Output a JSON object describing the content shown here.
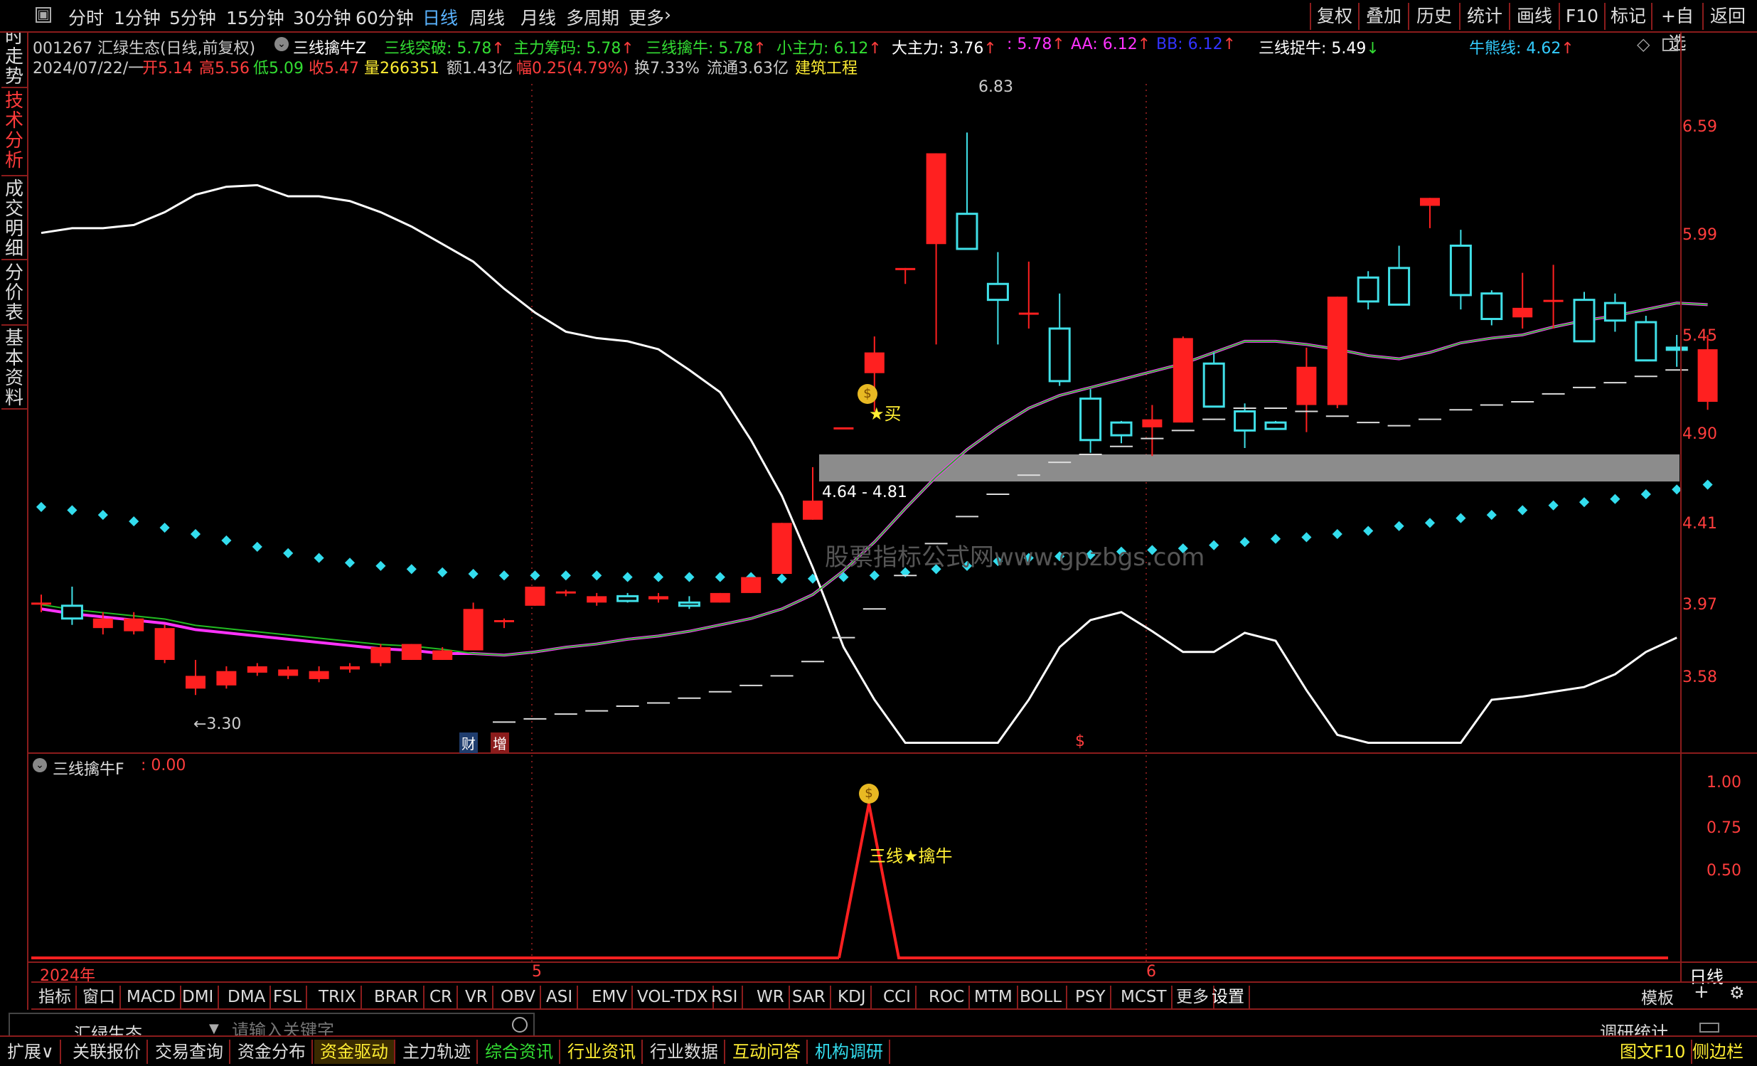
{
  "toolbar": {
    "left_tabs": [
      "分时",
      "1分钟",
      "5分钟",
      "15分钟",
      "30分钟",
      "60分钟",
      "日线",
      "周线",
      "月线",
      "多周期",
      "更多"
    ],
    "active_tab": "日线",
    "right_buttons": [
      "复权",
      "叠加",
      "历史",
      "统计",
      "画线",
      "F10",
      "标记",
      "+自选",
      "返回"
    ]
  },
  "sidebar": {
    "tabs": [
      "分时走势",
      "技术分析",
      "成交明细",
      "分价表",
      "基本资料"
    ],
    "active": "技术分析"
  },
  "header": {
    "stock": "001267 汇绿生态(日线,前复权)",
    "indicator_name": "三线擒牛Z",
    "items": [
      {
        "label": "三线突破: 5.78",
        "arrow": "↑",
        "color": "#33dd33"
      },
      {
        "label": "主力筹码: 5.78",
        "arrow": "↑",
        "color": "#33dd33"
      },
      {
        "label": "三线擒牛: 5.78",
        "arrow": "↑",
        "color": "#33dd33"
      },
      {
        "label": "小主力: 6.12",
        "arrow": "↑",
        "color": "#33dd33"
      },
      {
        "label": "大主力: 3.76",
        "arrow": "↑",
        "color": "#ffffff"
      },
      {
        "label": ": 5.78",
        "arrow": "↑",
        "color": "#ff33ff"
      },
      {
        "label": "AA: 6.12",
        "arrow": "↑",
        "color": "#ff33ff"
      },
      {
        "label": "BB: 6.12",
        "arrow": "↑",
        "color": "#3333ff"
      },
      {
        "label": "三线捉牛: 5.49",
        "arrow": "↓",
        "color": "#ffffff"
      },
      {
        "label": "牛熊线: 4.62",
        "arrow": "↑",
        "color": "#33ccff"
      }
    ],
    "date": "2024/07/22/一",
    "open": "开5.14",
    "high": "高5.56",
    "low": "低5.09",
    "close": "收5.47",
    "volume": "量266351",
    "amount": "额1.43亿",
    "change": "幅0.25(4.79%)",
    "turnover": "换7.33%",
    "float": "流通3.63亿",
    "industry": "建筑工程"
  },
  "main_chart": {
    "price_axis": [
      "6.59",
      "5.99",
      "5.45",
      "4.90",
      "4.41",
      "3.97",
      "3.58"
    ],
    "high_label": "6.83",
    "low_label": "←3.30",
    "zone_label": "4.64 - 4.81",
    "buy_label": "★买",
    "events": [
      "财",
      "增",
      "$"
    ],
    "watermark": "股票指标公式网www.gpzbgs.com"
  },
  "chart_data": {
    "type": "candlestick",
    "period": "daily",
    "ohlc": [
      [
        3.88,
        3.93,
        3.82,
        3.88
      ],
      [
        3.86,
        3.98,
        3.74,
        3.78
      ],
      [
        3.72,
        3.82,
        3.68,
        3.78
      ],
      [
        3.7,
        3.82,
        3.68,
        3.78
      ],
      [
        3.52,
        3.74,
        3.5,
        3.72
      ],
      [
        3.34,
        3.52,
        3.3,
        3.42
      ],
      [
        3.36,
        3.48,
        3.34,
        3.45
      ],
      [
        3.44,
        3.5,
        3.42,
        3.48
      ],
      [
        3.42,
        3.48,
        3.4,
        3.46
      ],
      [
        3.4,
        3.48,
        3.38,
        3.45
      ],
      [
        3.46,
        3.5,
        3.44,
        3.48
      ],
      [
        3.5,
        3.62,
        3.48,
        3.6
      ],
      [
        3.52,
        3.62,
        3.52,
        3.62
      ],
      [
        3.52,
        3.6,
        3.52,
        3.58
      ],
      [
        3.58,
        3.88,
        3.58,
        3.84
      ],
      [
        3.77,
        3.78,
        3.72,
        3.77
      ],
      [
        3.86,
        3.98,
        3.86,
        3.98
      ],
      [
        3.94,
        3.96,
        3.92,
        3.95
      ],
      [
        3.88,
        3.94,
        3.86,
        3.92
      ],
      [
        3.92,
        3.94,
        3.88,
        3.89
      ],
      [
        3.9,
        3.94,
        3.88,
        3.92
      ],
      [
        3.88,
        3.92,
        3.84,
        3.86
      ],
      [
        3.88,
        3.94,
        3.88,
        3.94
      ],
      [
        3.94,
        4.04,
        3.94,
        4.04
      ],
      [
        4.06,
        4.38,
        4.06,
        4.38
      ],
      [
        4.4,
        4.73,
        4.4,
        4.52
      ],
      [
        4.98,
        4.98,
        4.98,
        4.98
      ],
      [
        5.32,
        5.55,
        5.08,
        5.45
      ],
      [
        5.98,
        5.98,
        5.88,
        5.98
      ],
      [
        6.13,
        6.7,
        5.5,
        6.7
      ],
      [
        6.32,
        6.83,
        6.22,
        6.1
      ],
      [
        5.88,
        6.08,
        5.5,
        5.78
      ],
      [
        5.7,
        6.02,
        5.6,
        5.7
      ],
      [
        5.6,
        5.82,
        5.24,
        5.27
      ],
      [
        5.16,
        5.22,
        4.82,
        4.9
      ],
      [
        5.01,
        5.02,
        4.88,
        4.93
      ],
      [
        4.98,
        5.12,
        4.8,
        5.03
      ],
      [
        5.01,
        5.55,
        5.01,
        5.54
      ],
      [
        5.38,
        5.45,
        5.12,
        5.11
      ],
      [
        5.08,
        5.13,
        4.85,
        4.96
      ],
      [
        5.01,
        5.02,
        4.97,
        4.97
      ],
      [
        5.12,
        5.48,
        4.95,
        5.36
      ],
      [
        5.12,
        5.8,
        5.1,
        5.8
      ],
      [
        5.92,
        5.96,
        5.72,
        5.77
      ],
      [
        5.98,
        6.12,
        5.75,
        5.75
      ],
      [
        6.37,
        6.42,
        6.23,
        6.42
      ],
      [
        6.12,
        6.22,
        5.72,
        5.81
      ],
      [
        5.82,
        5.84,
        5.62,
        5.66
      ],
      [
        5.67,
        5.95,
        5.6,
        5.73
      ],
      [
        5.78,
        6.0,
        5.6,
        5.78
      ],
      [
        5.78,
        5.83,
        5.52,
        5.52
      ],
      [
        5.76,
        5.82,
        5.58,
        5.65
      ],
      [
        5.64,
        5.68,
        5.4,
        5.4
      ],
      [
        5.48,
        5.56,
        5.36,
        5.47
      ],
      [
        5.14,
        5.56,
        5.09,
        5.47
      ]
    ],
    "series": [
      {
        "name": "三线擒牛",
        "color": "#ff33ff",
        "values": [
          3.84,
          3.81,
          3.79,
          3.77,
          3.75,
          3.71,
          3.69,
          3.67,
          3.65,
          3.63,
          3.61,
          3.59,
          3.58,
          3.56,
          3.56,
          3.55,
          3.57,
          3.6,
          3.62,
          3.65,
          3.67,
          3.7,
          3.74,
          3.78,
          3.84,
          3.93,
          4.08,
          4.26,
          4.47,
          4.67,
          4.84,
          4.98,
          5.1,
          5.18,
          5.23,
          5.28,
          5.33,
          5.38,
          5.45,
          5.52,
          5.52,
          5.5,
          5.47,
          5.43,
          5.41,
          5.45,
          5.51,
          5.54,
          5.56,
          5.61,
          5.65,
          5.68,
          5.72,
          5.76,
          5.75
        ]
      },
      {
        "name": "牛熊线",
        "color": "#33ddee",
        "values": [
          4.48,
          4.46,
          4.43,
          4.39,
          4.35,
          4.31,
          4.27,
          4.23,
          4.19,
          4.16,
          4.13,
          4.11,
          4.09,
          4.07,
          4.06,
          4.05,
          4.05,
          4.05,
          4.05,
          4.04,
          4.04,
          4.04,
          4.04,
          4.04,
          4.03,
          4.03,
          4.04,
          4.05,
          4.07,
          4.09,
          4.11,
          4.14,
          4.16,
          4.17,
          4.18,
          4.2,
          4.21,
          4.22,
          4.24,
          4.26,
          4.28,
          4.29,
          4.31,
          4.33,
          4.36,
          4.38,
          4.41,
          4.43,
          4.46,
          4.49,
          4.51,
          4.53,
          4.56,
          4.59,
          4.62
        ]
      },
      {
        "name": "大主力",
        "color": "#ffffff",
        "values": [
          6.2,
          6.23,
          6.23,
          6.25,
          6.33,
          6.44,
          6.49,
          6.5,
          6.43,
          6.43,
          6.4,
          6.33,
          6.24,
          6.13,
          6.02,
          5.85,
          5.7,
          5.58,
          5.54,
          5.52,
          5.47,
          5.34,
          5.2,
          4.9,
          4.55,
          4.1,
          3.6,
          3.27,
          3.0,
          3.0,
          3.0,
          3.0,
          3.27,
          3.6,
          3.77,
          3.82,
          3.7,
          3.57,
          3.57,
          3.69,
          3.64,
          3.33,
          3.05,
          3.0,
          3.0,
          3.0,
          3.0,
          3.27,
          3.29,
          3.32,
          3.35,
          3.43,
          3.57,
          3.66
        ]
      }
    ],
    "price_range": [
      3.02,
      7.18
    ],
    "zone": [
      4.64,
      4.81
    ]
  },
  "sub_chart": {
    "title": "三线擒牛F",
    "value": ": 0.00",
    "axis": [
      "1.00",
      "0.75",
      "0.50"
    ],
    "label": "三线★擒牛"
  },
  "time_axis": {
    "labels": [
      "2024年",
      "5",
      "6"
    ],
    "period": "日线"
  },
  "indicator_tabs": [
    "指标",
    "窗口",
    "MACD",
    "DMI",
    "DMA",
    "FSL",
    "TRIX",
    "BRAR",
    "CR",
    "VR",
    "OBV",
    "ASI",
    "EMV",
    "VOL-TDX",
    "RSI",
    "WR",
    "SAR",
    "KDJ",
    "CCI",
    "ROC",
    "MTM",
    "BOLL",
    "PSY",
    "MCST",
    "更多",
    "设置"
  ],
  "template_tab": "模板",
  "search": {
    "stock": "汇绿生态",
    "placeholder": "请输入关键字",
    "right_label": "调研统计"
  },
  "bottom_tabs": [
    "扩展∨",
    "关联报价",
    "交易查询",
    "资金分布",
    "资金驱动",
    "主力轨迹",
    "综合资讯",
    "行业资讯",
    "行业数据",
    "互动问答",
    "机构调研"
  ],
  "bottom_right": [
    "图文F10",
    "侧边栏《"
  ]
}
